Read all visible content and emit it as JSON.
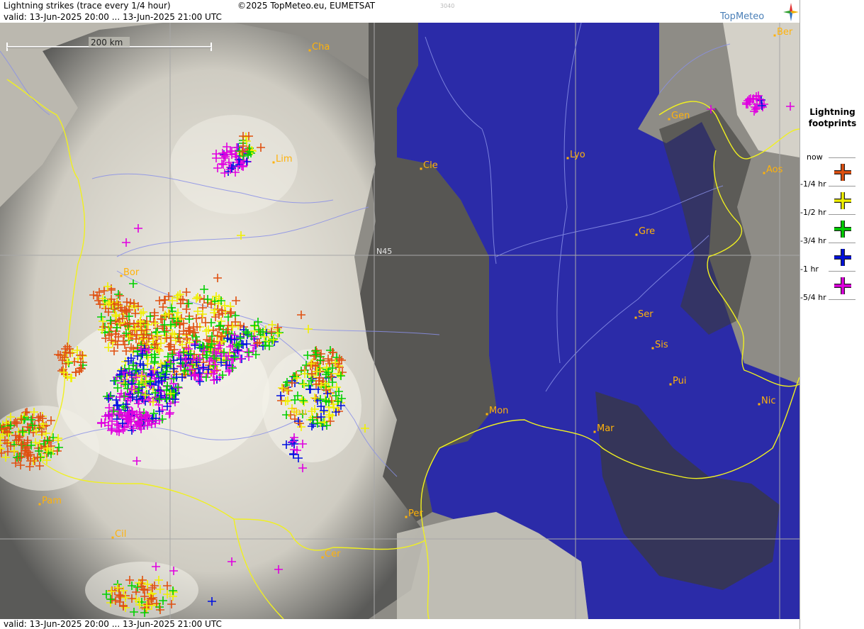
{
  "header": {
    "title": "Lightning strikes (trace every 1/4 hour)",
    "valid": "valid:  13-Jun-2025 20:00 ... 13-Jun-2025 21:00 UTC",
    "copyright": "©2025 TopMeteo.eu, EUMETSAT",
    "code": "3040",
    "logo": "TopMeteo"
  },
  "footer": {
    "valid": "valid:  13-Jun-2025 20:00 ... 13-Jun-2025 21:00 UTC"
  },
  "map": {
    "scale_label": "200 km",
    "grid_label": "N45",
    "cities": [
      {
        "id": "cha",
        "label": "Cha"
      },
      {
        "id": "lim",
        "label": "Lim"
      },
      {
        "id": "cle",
        "label": "Cle"
      },
      {
        "id": "lyo",
        "label": "Lyo"
      },
      {
        "id": "gen",
        "label": "Gen"
      },
      {
        "id": "ber",
        "label": "Ber"
      },
      {
        "id": "aos",
        "label": "Aos"
      },
      {
        "id": "gre",
        "label": "Gre"
      },
      {
        "id": "bor",
        "label": "Bor"
      },
      {
        "id": "ser",
        "label": "Ser"
      },
      {
        "id": "sis",
        "label": "Sis"
      },
      {
        "id": "pui",
        "label": "Pui"
      },
      {
        "id": "tou",
        "label": "Tou"
      },
      {
        "id": "mon",
        "label": "Mon"
      },
      {
        "id": "mar",
        "label": "Mar"
      },
      {
        "id": "nic",
        "label": "Nic"
      },
      {
        "id": "pam",
        "label": "Pam"
      },
      {
        "id": "per",
        "label": "Per"
      },
      {
        "id": "cil",
        "label": "Cil"
      },
      {
        "id": "cer",
        "label": "Cer"
      }
    ]
  },
  "legend": {
    "title": "Lightning footprints",
    "items": [
      {
        "label": "now",
        "color": "#e05010"
      },
      {
        "label": "-1/4 hr",
        "color": "#f0f000"
      },
      {
        "label": "-1/2 hr",
        "color": "#00d000"
      },
      {
        "label": "-3/4 hr",
        "color": "#0010e0"
      },
      {
        "label": "-1 hr",
        "color": "#e000e0"
      },
      {
        "label": "-5/4 hr",
        "color": ""
      }
    ]
  },
  "colors": {
    "sea": "#2b2ba8",
    "cloud": "#e9e6dc",
    "border": "#f0f020",
    "river": "#8a90e8",
    "city": "#ffb20a"
  }
}
